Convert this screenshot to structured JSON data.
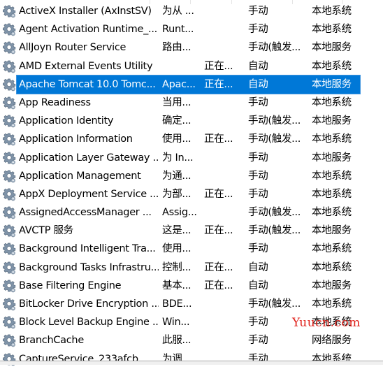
{
  "accent_color": "#0078d7",
  "selected_index": 4,
  "rows": [
    {
      "name": "ActiveX Installer (AxInstSV)",
      "desc": "为从 ...",
      "status": "",
      "startup": "手动",
      "logon": "本地系统"
    },
    {
      "name": "Agent Activation Runtime_...",
      "desc": "Runt...",
      "status": "",
      "startup": "手动",
      "logon": "本地系统"
    },
    {
      "name": "AllJoyn Router Service",
      "desc": "路由...",
      "status": "",
      "startup": "手动(触发...",
      "logon": "本地服务"
    },
    {
      "name": "AMD External Events Utility",
      "desc": "",
      "status": "正在...",
      "startup": "自动",
      "logon": "本地系统"
    },
    {
      "name": "Apache Tomcat 10.0 Tomc...",
      "desc": "Apac...",
      "status": "正在...",
      "startup": "自动",
      "logon": "本地服务"
    },
    {
      "name": "App Readiness",
      "desc": "当用...",
      "status": "",
      "startup": "手动",
      "logon": "本地系统"
    },
    {
      "name": "Application Identity",
      "desc": "确定...",
      "status": "",
      "startup": "手动(触发...",
      "logon": "本地服务"
    },
    {
      "name": "Application Information",
      "desc": "使用...",
      "status": "正在...",
      "startup": "手动(触发...",
      "logon": "本地系统"
    },
    {
      "name": "Application Layer Gateway ...",
      "desc": "为 In...",
      "status": "",
      "startup": "手动",
      "logon": "本地服务"
    },
    {
      "name": "Application Management",
      "desc": "为通...",
      "status": "",
      "startup": "手动",
      "logon": "本地系统"
    },
    {
      "name": "AppX Deployment Service ...",
      "desc": "为部...",
      "status": "正在...",
      "startup": "手动",
      "logon": "本地系统"
    },
    {
      "name": "AssignedAccessManager ...",
      "desc": "Assig...",
      "status": "",
      "startup": "手动(触发...",
      "logon": "本地系统"
    },
    {
      "name": "AVCTP 服务",
      "desc": "这是...",
      "status": "正在...",
      "startup": "手动(触发...",
      "logon": "本地服务"
    },
    {
      "name": "Background Intelligent Tra...",
      "desc": "使用...",
      "status": "",
      "startup": "手动",
      "logon": "本地系统"
    },
    {
      "name": "Background Tasks Infrastru...",
      "desc": "控制...",
      "status": "正在...",
      "startup": "自动",
      "logon": "本地系统"
    },
    {
      "name": "Base Filtering Engine",
      "desc": "基本...",
      "status": "正在...",
      "startup": "自动",
      "logon": "本地服务"
    },
    {
      "name": "BitLocker Drive Encryption ...",
      "desc": "BDE...",
      "status": "",
      "startup": "手动(触发...",
      "logon": "本地系统"
    },
    {
      "name": "Block Level Backup Engine ...",
      "desc": "Win...",
      "status": "",
      "startup": "手动",
      "logon": "本地系统"
    },
    {
      "name": "BranchCache",
      "desc": "此服...",
      "status": "",
      "startup": "手动",
      "logon": "网络服务"
    },
    {
      "name": "CaptureService_233afcb",
      "desc": "为调...",
      "status": "",
      "startup": "手动",
      "logon": "本地系统"
    }
  ],
  "watermark": "Yuucn.com"
}
